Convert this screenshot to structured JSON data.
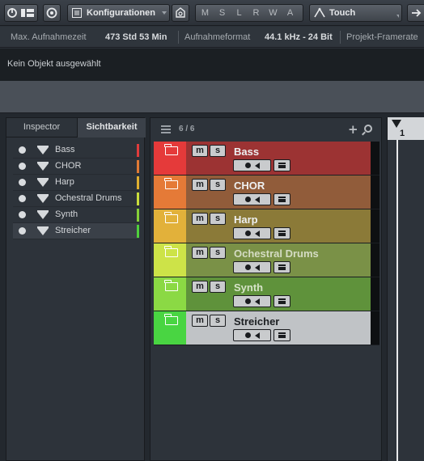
{
  "toolbar": {
    "config_label": "Konfigurationen",
    "modes": [
      "M",
      "S",
      "L",
      "R",
      "W",
      "A"
    ],
    "automation_mode": "Touch"
  },
  "infobar": {
    "rec_time_label": "Max. Aufnahmezeit",
    "rec_time_value": "473 Std 53 Min",
    "format_label": "Aufnahmeformat",
    "format_value": "44.1 kHz - 24 Bit",
    "framerate_label": "Projekt-Framerate"
  },
  "status": {
    "text": "Kein Objekt ausgewählt"
  },
  "leftpanel": {
    "tabs": [
      "Inspector",
      "Sichtbarkeit"
    ],
    "active_tab": "Sichtbarkeit",
    "items": [
      {
        "label": "Bass",
        "color": "#e03c3c"
      },
      {
        "label": "CHOR",
        "color": "#e07a34"
      },
      {
        "label": "Harp",
        "color": "#e0b030"
      },
      {
        "label": "Ochestral Drums",
        "color": "#c9dd3c"
      },
      {
        "label": "Synth",
        "color": "#86d038"
      },
      {
        "label": "Streicher",
        "color": "#4fd03c"
      }
    ]
  },
  "tracklist": {
    "count": "6 / 6",
    "tracks": [
      {
        "name": "Bass",
        "strip": "#e53a3a",
        "body": "#9c3333"
      },
      {
        "name": "CHOR",
        "strip": "#e57a37",
        "body": "#915c3a"
      },
      {
        "name": "Harp",
        "strip": "#e2b13a",
        "body": "#8b7a38"
      },
      {
        "name": "Ochestral Drums",
        "strip": "#cde348",
        "body": "#7a9147"
      },
      {
        "name": "Synth",
        "strip": "#8bd944",
        "body": "#5f923b"
      },
      {
        "name": "Streicher",
        "strip": "#49d542",
        "body": "#c0c3c6"
      }
    ]
  },
  "arrange": {
    "ruler_bar": "1"
  }
}
